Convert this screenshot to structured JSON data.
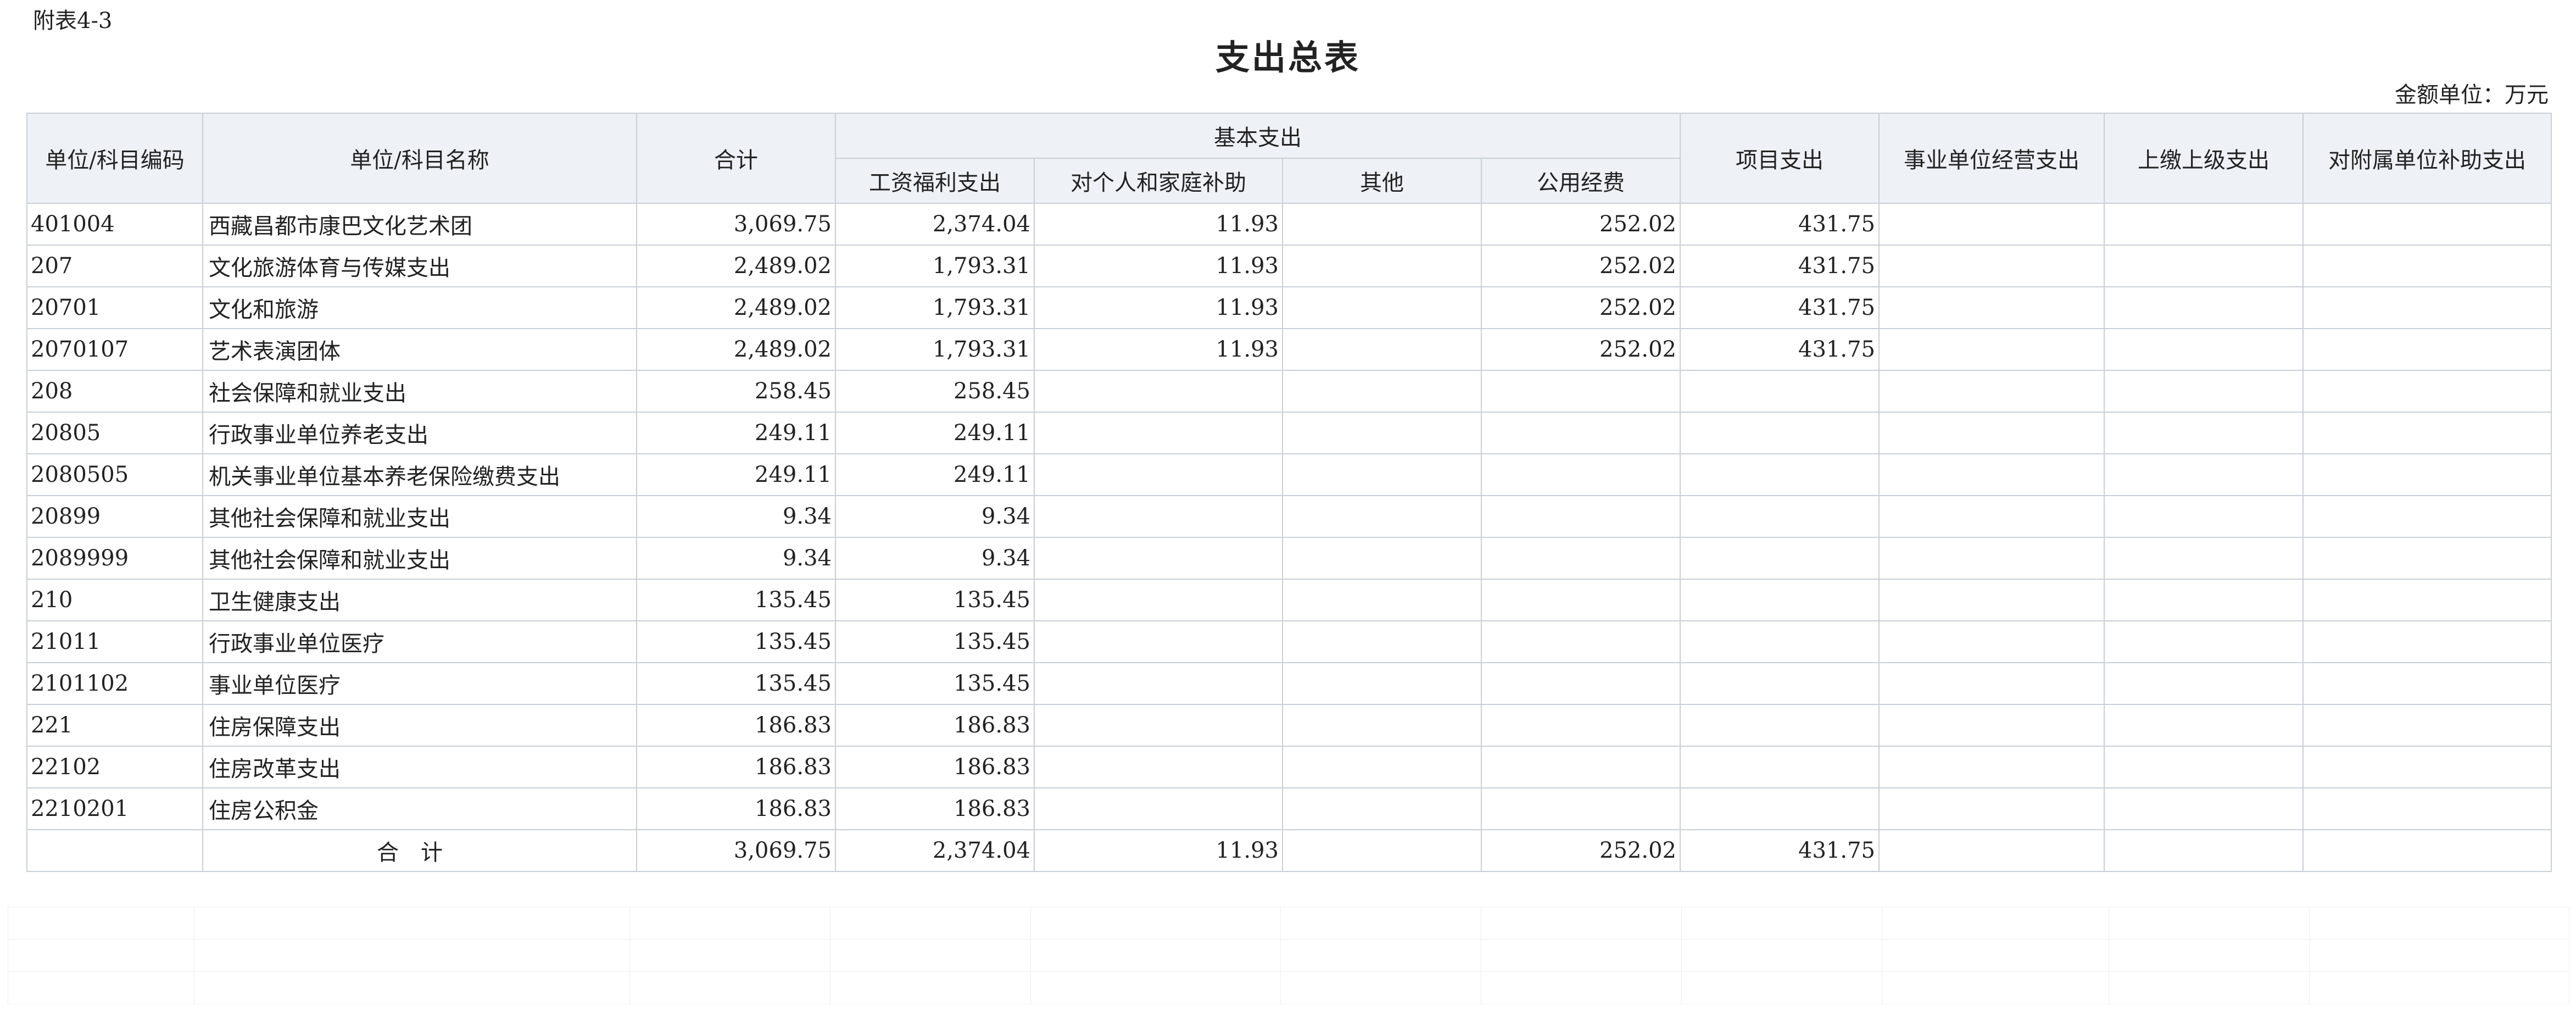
{
  "attachment_label": "附表4-3",
  "title": "支出总表",
  "unit_note": "金额单位：万元",
  "table": {
    "headers": {
      "code": "单位/科目编码",
      "name": "单位/科目名称",
      "total": "合计",
      "basic": "基本支出",
      "basic_sub": [
        "工资福利支出",
        "对个人和家庭补助",
        "其他",
        "公用经费"
      ],
      "project": "项目支出",
      "business": "事业单位经营支出",
      "upper": "上缴上级支出",
      "subsidiary": "对附属单位补助支出"
    },
    "rows": [
      {
        "code": "401004",
        "name": "西藏昌都市康巴文化艺术团",
        "total": "3,069.75",
        "salary": "2,374.04",
        "personal": "11.93",
        "other": "",
        "public": "252.02",
        "project": "431.75",
        "business": "",
        "upper": "",
        "subsidiary": ""
      },
      {
        "code": "207",
        "name": "文化旅游体育与传媒支出",
        "total": "2,489.02",
        "salary": "1,793.31",
        "personal": "11.93",
        "other": "",
        "public": "252.02",
        "project": "431.75",
        "business": "",
        "upper": "",
        "subsidiary": ""
      },
      {
        "code": "20701",
        "name": "文化和旅游",
        "total": "2,489.02",
        "salary": "1,793.31",
        "personal": "11.93",
        "other": "",
        "public": "252.02",
        "project": "431.75",
        "business": "",
        "upper": "",
        "subsidiary": ""
      },
      {
        "code": "2070107",
        "name": "艺术表演团体",
        "total": "2,489.02",
        "salary": "1,793.31",
        "personal": "11.93",
        "other": "",
        "public": "252.02",
        "project": "431.75",
        "business": "",
        "upper": "",
        "subsidiary": ""
      },
      {
        "code": "208",
        "name": "社会保障和就业支出",
        "total": "258.45",
        "salary": "258.45",
        "personal": "",
        "other": "",
        "public": "",
        "project": "",
        "business": "",
        "upper": "",
        "subsidiary": ""
      },
      {
        "code": "20805",
        "name": "行政事业单位养老支出",
        "total": "249.11",
        "salary": "249.11",
        "personal": "",
        "other": "",
        "public": "",
        "project": "",
        "business": "",
        "upper": "",
        "subsidiary": ""
      },
      {
        "code": "2080505",
        "name": "机关事业单位基本养老保险缴费支出",
        "total": "249.11",
        "salary": "249.11",
        "personal": "",
        "other": "",
        "public": "",
        "project": "",
        "business": "",
        "upper": "",
        "subsidiary": ""
      },
      {
        "code": "20899",
        "name": "其他社会保障和就业支出",
        "total": "9.34",
        "salary": "9.34",
        "personal": "",
        "other": "",
        "public": "",
        "project": "",
        "business": "",
        "upper": "",
        "subsidiary": ""
      },
      {
        "code": "2089999",
        "name": "其他社会保障和就业支出",
        "total": "9.34",
        "salary": "9.34",
        "personal": "",
        "other": "",
        "public": "",
        "project": "",
        "business": "",
        "upper": "",
        "subsidiary": ""
      },
      {
        "code": "210",
        "name": "卫生健康支出",
        "total": "135.45",
        "salary": "135.45",
        "personal": "",
        "other": "",
        "public": "",
        "project": "",
        "business": "",
        "upper": "",
        "subsidiary": ""
      },
      {
        "code": "21011",
        "name": "行政事业单位医疗",
        "total": "135.45",
        "salary": "135.45",
        "personal": "",
        "other": "",
        "public": "",
        "project": "",
        "business": "",
        "upper": "",
        "subsidiary": ""
      },
      {
        "code": "2101102",
        "name": "事业单位医疗",
        "total": "135.45",
        "salary": "135.45",
        "personal": "",
        "other": "",
        "public": "",
        "project": "",
        "business": "",
        "upper": "",
        "subsidiary": ""
      },
      {
        "code": "221",
        "name": "住房保障支出",
        "total": "186.83",
        "salary": "186.83",
        "personal": "",
        "other": "",
        "public": "",
        "project": "",
        "business": "",
        "upper": "",
        "subsidiary": ""
      },
      {
        "code": "22102",
        "name": "住房改革支出",
        "total": "186.83",
        "salary": "186.83",
        "personal": "",
        "other": "",
        "public": "",
        "project": "",
        "business": "",
        "upper": "",
        "subsidiary": ""
      },
      {
        "code": "2210201",
        "name": "住房公积金",
        "total": "186.83",
        "salary": "186.83",
        "personal": "",
        "other": "",
        "public": "",
        "project": "",
        "business": "",
        "upper": "",
        "subsidiary": ""
      }
    ],
    "total_row": {
      "code": "",
      "name": "合计",
      "total": "3,069.75",
      "salary": "2,374.04",
      "personal": "11.93",
      "other": "",
      "public": "252.02",
      "project": "431.75",
      "business": "",
      "upper": "",
      "subsidiary": ""
    }
  }
}
